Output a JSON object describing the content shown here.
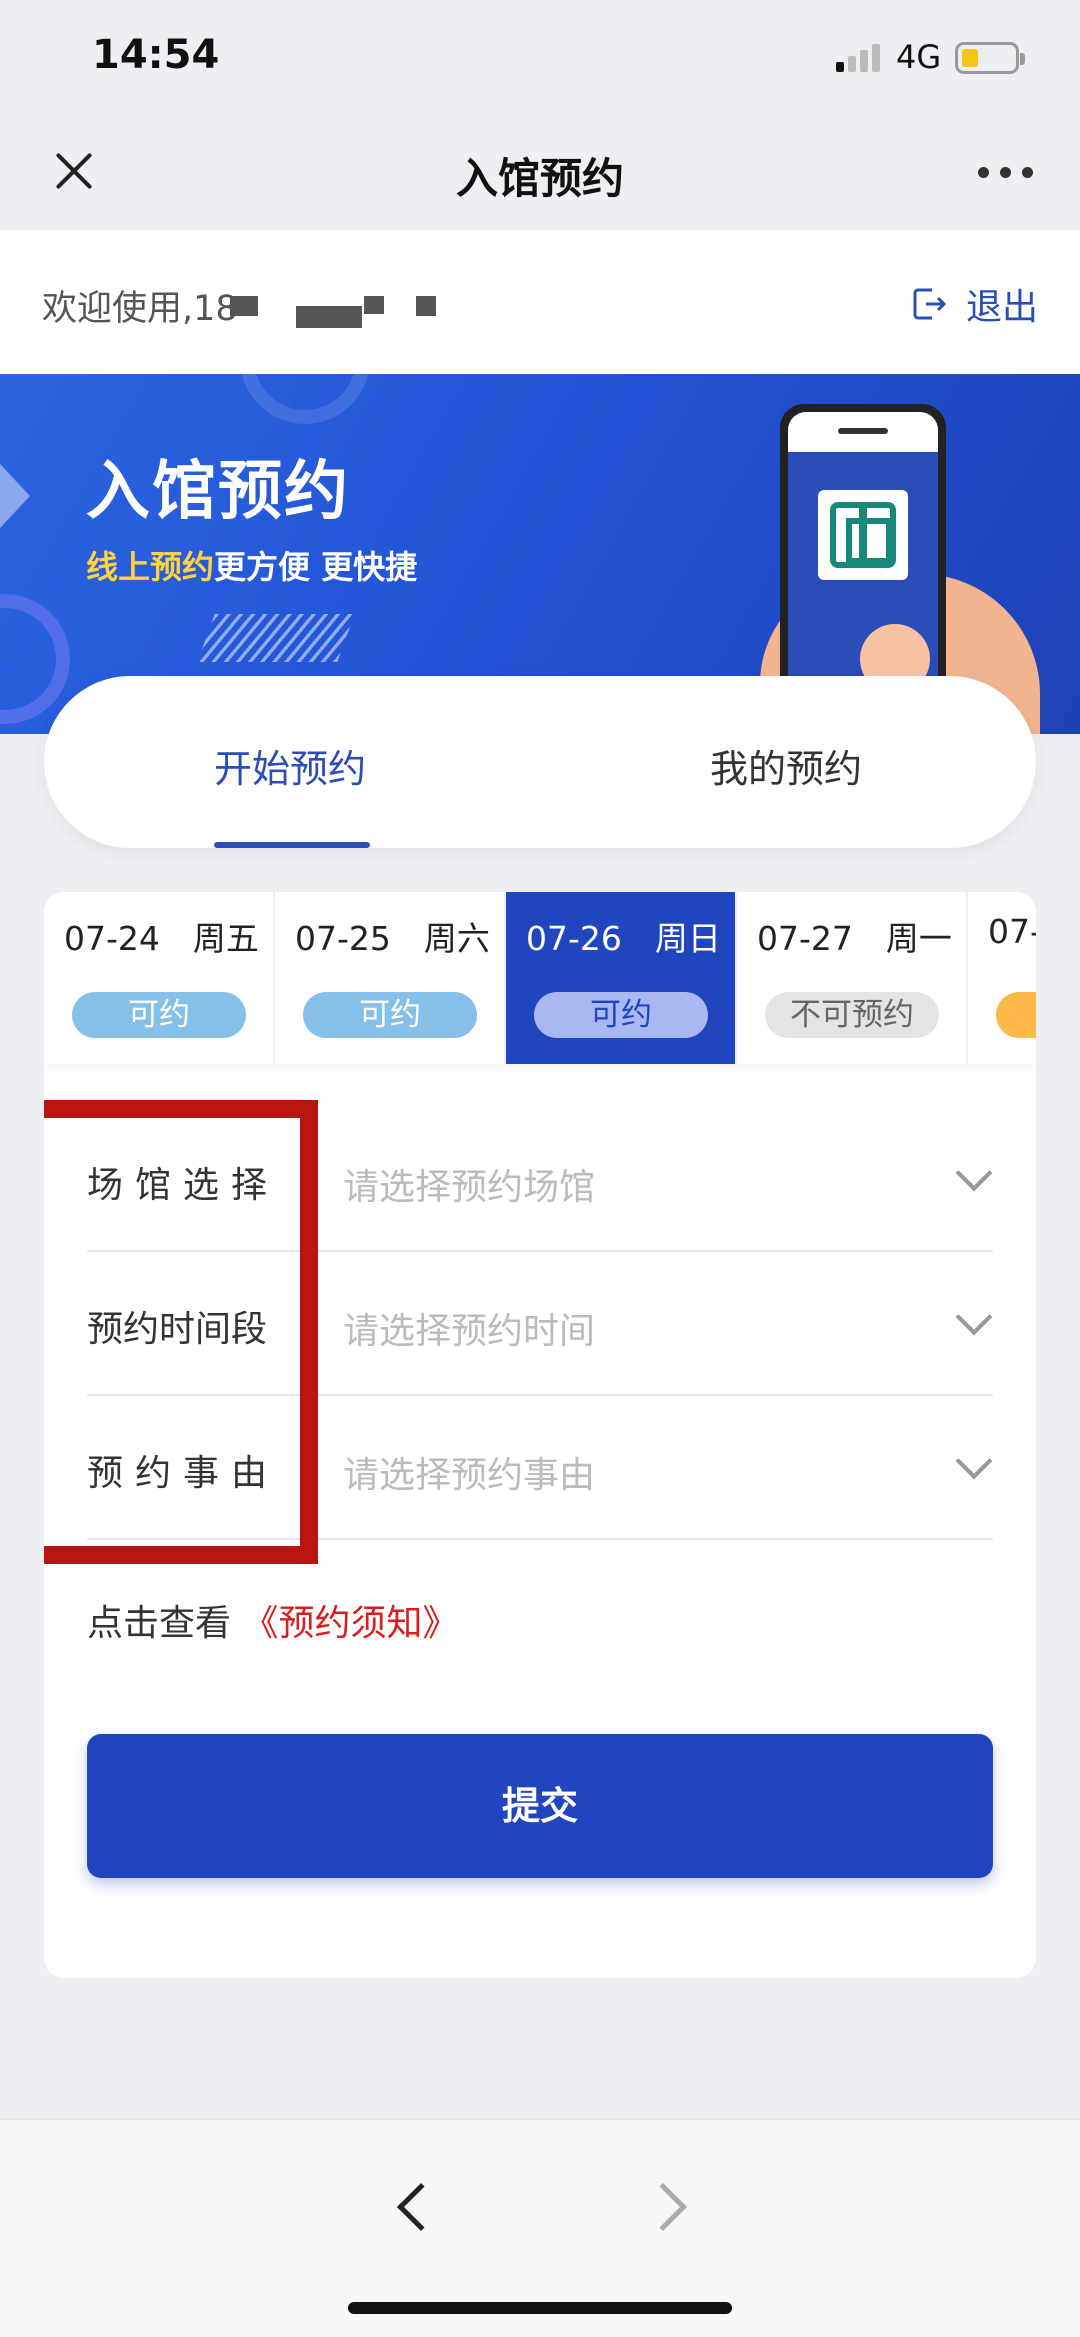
{
  "status": {
    "time": "14:54",
    "network": "4G"
  },
  "nav": {
    "title": "入馆预约"
  },
  "welcome": {
    "text": "欢迎使用,18",
    "logout_label": "退出"
  },
  "banner": {
    "title": "入馆预约",
    "subtitle_highlight": "线上预约",
    "subtitle_rest": "更方便 更快捷"
  },
  "tabs": [
    {
      "label": "开始预约",
      "active": true
    },
    {
      "label": "我的预约",
      "active": false
    }
  ],
  "dates": [
    {
      "label": "07-24　周五",
      "status": "可约"
    },
    {
      "label": "07-25　周六",
      "status": "可约"
    },
    {
      "label": "07-26　周日",
      "status": "可约",
      "selected": true
    },
    {
      "label": "07-27　周一",
      "status": "不可预约"
    },
    {
      "label": "07-",
      "status": ""
    }
  ],
  "form": {
    "venue": {
      "label": "场馆选择",
      "placeholder": "请选择预约场馆"
    },
    "time": {
      "label": "预约时间段",
      "placeholder": "请选择预约时间"
    },
    "reason": {
      "label": "预约事由",
      "placeholder": "请选择预约事由"
    }
  },
  "notice": {
    "prefix": "点击查看",
    "link": "《预约须知》"
  },
  "submit_label": "提交",
  "colors": {
    "primary": "#2145bf",
    "highlight_box": "#b81510",
    "link_red": "#d81e1e"
  }
}
